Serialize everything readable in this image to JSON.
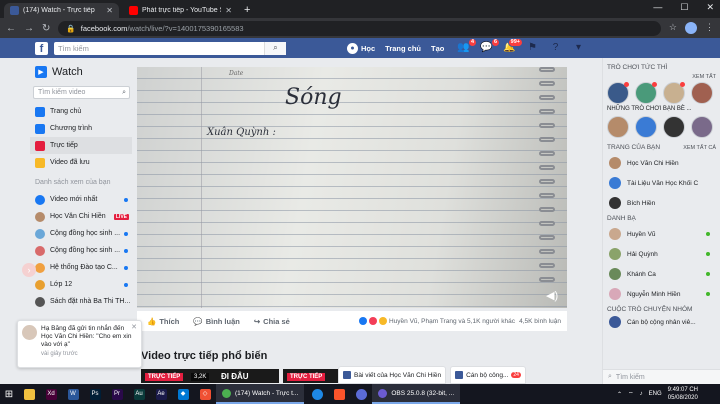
{
  "browser": {
    "tabs": [
      {
        "title": "(174) Watch - Trực tiếp",
        "active": true,
        "favicon_color": "#3b5998"
      },
      {
        "title": "Phát trực tiếp - YouTube Studio",
        "active": false,
        "favicon_color": "#ff0000"
      }
    ],
    "url_host": "facebook.com",
    "url_path": "/watch/live/?v=1400175390165583",
    "icons": [
      "back-icon",
      "forward-icon",
      "reload-icon",
      "lock-icon",
      "star-icon",
      "menu-icon"
    ]
  },
  "facebook": {
    "search_placeholder": "Tìm kiếm",
    "user_name": "Học",
    "nav": [
      "Trang chủ",
      "Tạo"
    ],
    "badges": {
      "friends": "4",
      "messages": "6",
      "notifications": "99+"
    }
  },
  "watch": {
    "title": "Watch",
    "search_placeholder": "Tìm kiếm video",
    "menu": [
      {
        "label": "Trang chủ",
        "color": "#1877f2",
        "selected": false
      },
      {
        "label": "Chương trình",
        "color": "#1877f2",
        "selected": false
      },
      {
        "label": "Trực tiếp",
        "color": "#e41e3f",
        "selected": true
      },
      {
        "label": "Video đã lưu",
        "color": "#f7b928",
        "selected": false
      }
    ],
    "section_label": "Danh sách xem của bạn",
    "watchlist": [
      {
        "label": "Video mới nhất",
        "color": "#1877f2",
        "dot": true,
        "live": ""
      },
      {
        "label": "Học Văn Chi Hiền",
        "color": "#b58b6a",
        "dot": false,
        "live": "LIVE"
      },
      {
        "label": "Cộng đồng học sinh ...",
        "color": "#6aa7d8",
        "dot": true,
        "live": ""
      },
      {
        "label": "Cộng đồng học sinh ...",
        "color": "#d86a6a",
        "dot": true,
        "live": ""
      },
      {
        "label": "Hệ thống Đào tạo C...",
        "color": "#f0a040",
        "dot": true,
        "live": ""
      },
      {
        "label": "Lớp 12",
        "color": "#e8a030",
        "dot": true,
        "live": ""
      },
      {
        "label": "Sách đặt nhà Ba Thi TH...",
        "color": "#555",
        "dot": false,
        "live": ""
      }
    ]
  },
  "video": {
    "handwriting_title": "Sóng",
    "handwriting_subtitle": "Xuân Quỳnh :",
    "handwriting_date": "Date"
  },
  "actions": {
    "like": "Thích",
    "comment": "Bình luận",
    "share": "Chia sẻ",
    "reactions_text": "Huyền Vũ, Phạm Trang và 5,1K người khác",
    "views": "4,5K bình luận"
  },
  "popular": {
    "heading": "Video trực tiếp phổ biến",
    "thumbs": [
      {
        "live": "TRỰC TIẾP",
        "views": "3,2K",
        "title": "ĐI ĐÂU"
      },
      {
        "live": "TRỰC TIẾP",
        "views": "",
        "title": ""
      }
    ]
  },
  "toast": {
    "text": "Hạ Băng đã gửi tin nhắn đến Học Văn Chi Hiền: \"Cho em xin vào với ạ\"",
    "time": "vài giây trước"
  },
  "right_sidebar": {
    "games_heading": "TRÒ CHƠI TỨC THÌ",
    "games_more": "XEM TẤT",
    "games_sub": "NHỮNG TRÒ CHƠI BẠN BÈ ...",
    "pages_heading": "TRANG CỦA BẠN",
    "pages_more": "XEM TẤT CẢ",
    "pages": [
      {
        "name": "Học Văn Chi Hiền",
        "color": "#b58b6a"
      },
      {
        "name": "Tài Liệu Văn Học Khối C",
        "color": "#3a7bd5"
      },
      {
        "name": "Bích Hiền",
        "color": "#333"
      }
    ],
    "contacts_heading": "DANH BẠ",
    "contacts": [
      {
        "name": "Huyền Vũ",
        "color": "#c9a88e",
        "online": true
      },
      {
        "name": "Hải Quỳnh",
        "color": "#8aa36a",
        "online": true
      },
      {
        "name": "Khánh Ca",
        "color": "#6a8a5a",
        "online": true
      },
      {
        "name": "Nguyễn Minh Hiền",
        "color": "#d8a8b8",
        "online": true
      }
    ],
    "groups_heading": "CUỘC TRÒ CHUYỆN NHÓM",
    "groups": [
      {
        "name": "Cán bộ cộng nhân viê...",
        "color": "#3b5998"
      }
    ],
    "search_placeholder": "Tìm kiếm"
  },
  "chat_tabs": [
    {
      "label": "Bài viết của Học Văn Chi Hiền",
      "count": ""
    },
    {
      "label": "Cán bộ công...",
      "count": "24"
    }
  ],
  "taskbar": {
    "windows": [
      {
        "label": "(174) Watch - Trực t...",
        "color": "#4caf50"
      },
      {
        "label": "OBS 25.0.8 (32-bit, ...",
        "color": "#6b5bd2"
      }
    ],
    "clock_time": "9:49:07 CH",
    "clock_date": "05/08/2020",
    "language": "ENG"
  }
}
